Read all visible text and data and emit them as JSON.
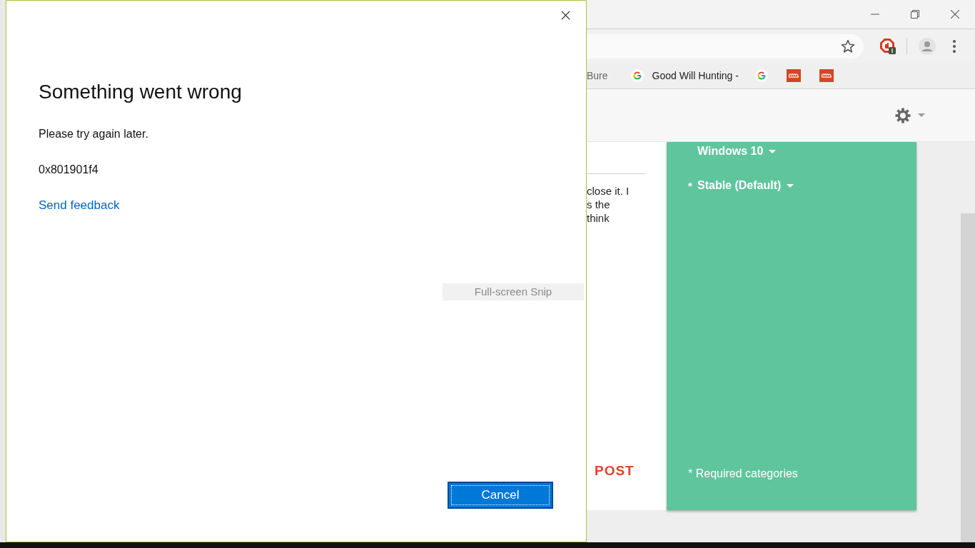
{
  "dialog": {
    "title": "Something went wrong",
    "message": "Please try again later.",
    "error_code": "0x801901f4",
    "link": "Send feedback",
    "buttons": [
      {
        "label": "Cancel",
        "focused": true
      }
    ]
  },
  "snip_overlay": {
    "label": "Full-screen Snip"
  },
  "browser": {
    "bookmarks": [
      {
        "kind": "text",
        "label": "Bure"
      },
      {
        "kind": "google",
        "label": "Good Will Hunting -"
      },
      {
        "kind": "google"
      },
      {
        "kind": "tile"
      },
      {
        "kind": "tile"
      }
    ],
    "page": {
      "card": {
        "lines": [
          "close it. I",
          "s the",
          "think"
        ],
        "action": "POST"
      },
      "panel": {
        "fields": [
          {
            "label": "Windows 10"
          },
          {
            "marker": "*",
            "label": "Stable (Default)"
          }
        ],
        "note": "* Required categories"
      }
    }
  }
}
